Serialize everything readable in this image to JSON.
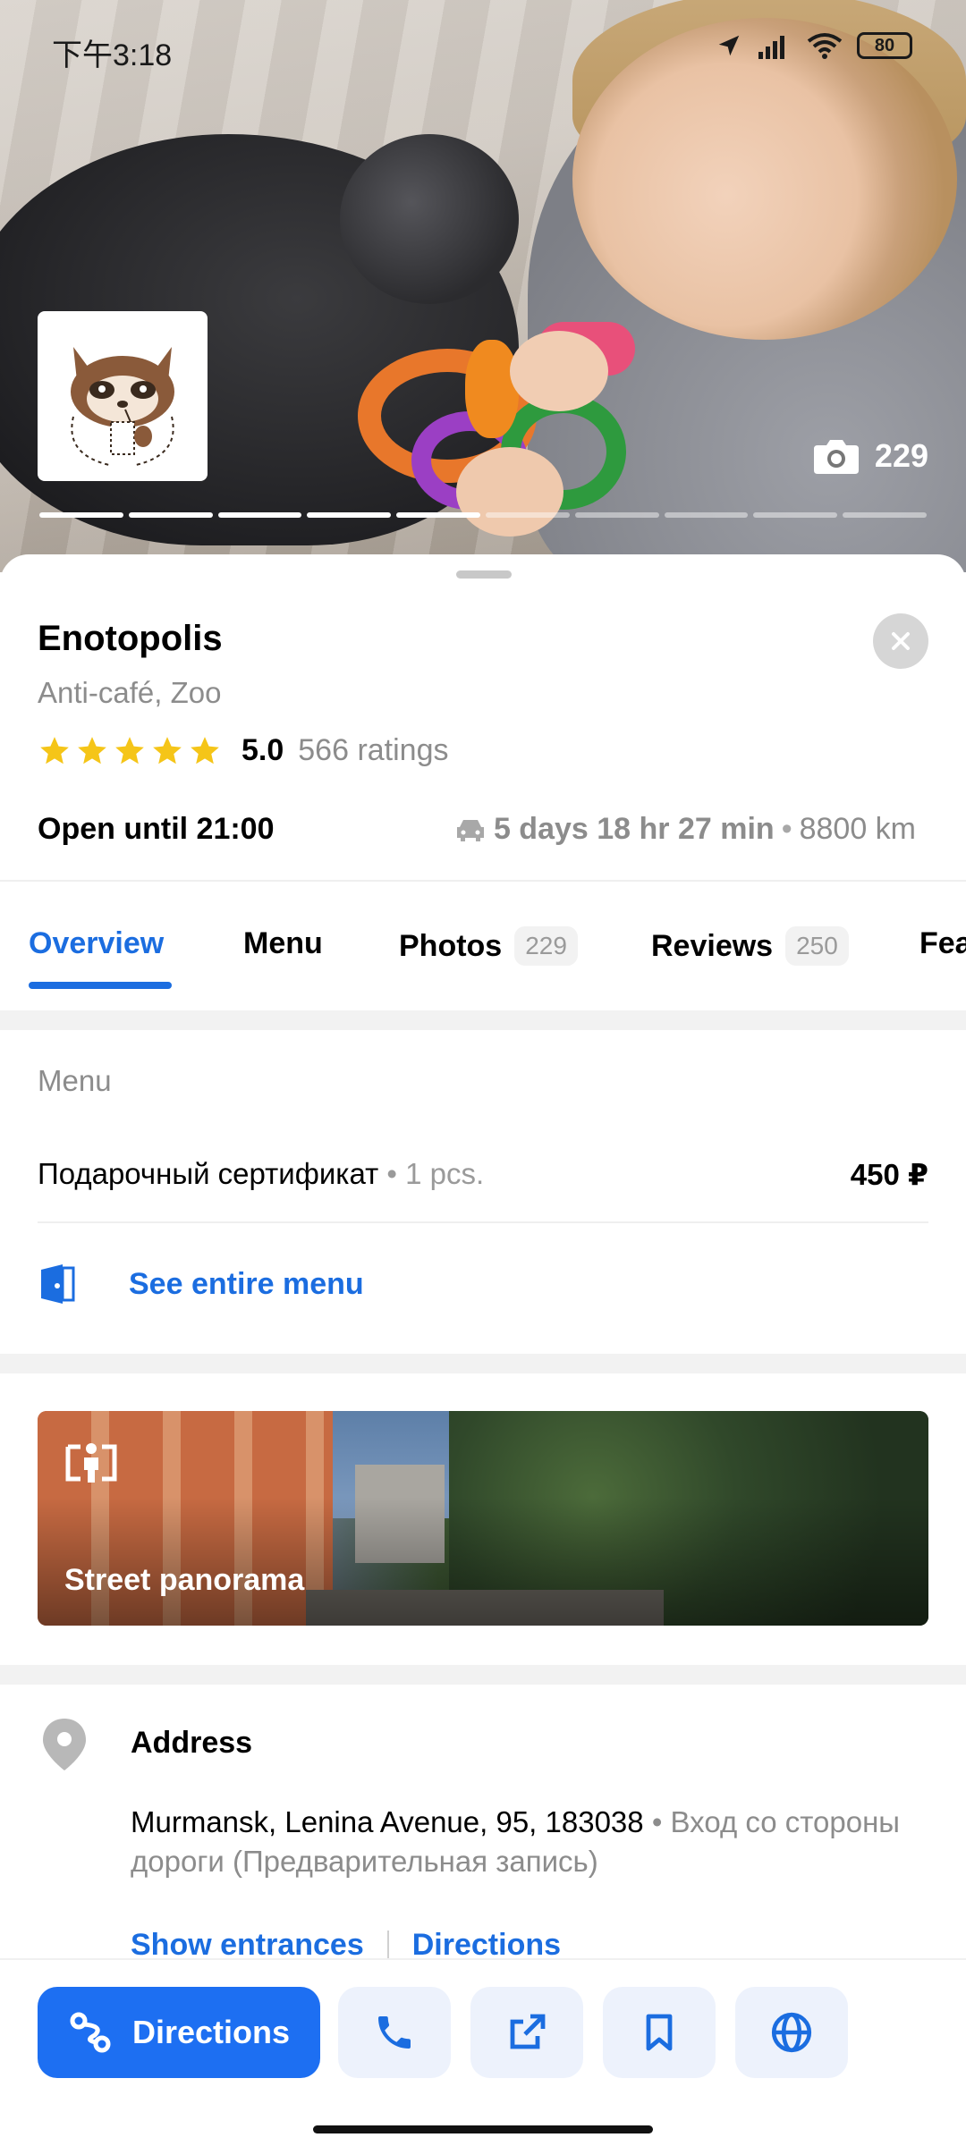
{
  "status_bar": {
    "time": "下午3:18",
    "battery": "80"
  },
  "hero": {
    "photo_count": "229",
    "progress_total": 10,
    "progress_done": 5
  },
  "place": {
    "name": "Enotopolis",
    "category": "Anti-café, Zoo",
    "rating": "5.0",
    "ratings_count": "566 ratings",
    "open_status": "Open until 21:00",
    "travel_time": "5 days 18 hr 27 min",
    "distance": "8800 km"
  },
  "tabs": [
    {
      "label": "Overview",
      "active": true
    },
    {
      "label": "Menu"
    },
    {
      "label": "Photos",
      "badge": "229"
    },
    {
      "label": "Reviews",
      "badge": "250"
    },
    {
      "label": "Fea"
    }
  ],
  "menu": {
    "heading": "Menu",
    "item_name": "Подарочный сертификат",
    "item_qty": "1 pcs.",
    "item_price": "450 ₽",
    "see_all": "See entire menu"
  },
  "panorama": {
    "label": "Street panorama"
  },
  "address": {
    "title": "Address",
    "main": "Murmansk, Lenina Avenue, 95, 183038",
    "note": "Вход со стороны дороги (Предварительная запись)",
    "link_entrances": "Show entrances",
    "link_directions": "Directions"
  },
  "bottom_bar": {
    "directions_label": "Directions"
  },
  "colors": {
    "accent": "#1b6de0",
    "button_blue": "#1d6ff2",
    "star": "#f5c518"
  },
  "icons": [
    "camera-icon",
    "close-icon",
    "star-icon",
    "car-icon",
    "menu-book-icon",
    "panorama-icon",
    "location-pin-icon",
    "route-icon",
    "phone-icon",
    "share-icon",
    "bookmark-icon",
    "globe-icon"
  ]
}
